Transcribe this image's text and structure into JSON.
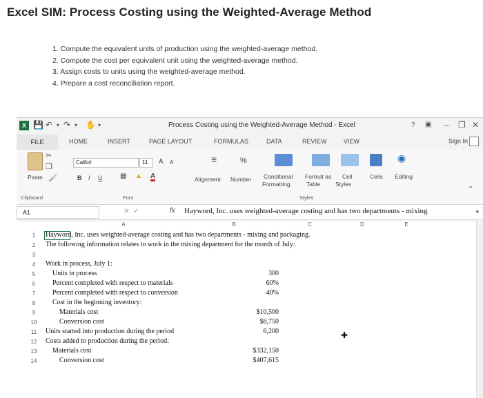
{
  "page": {
    "title": "Excel SIM: Process Costing using the Weighted-Average Method",
    "steps": [
      "1. Compute the equivalent units of production using the weighted-average method.",
      "2. Compute the cost per equivalent unit using the weighted-average method.",
      "3. Assign costs to units using the weighted-average method.",
      "4. Prepare a cost reconciliation report."
    ]
  },
  "excel": {
    "window_title": "Process Costing using the Weighted-Average Method - Excel",
    "help": "?",
    "tabs": [
      "FILE",
      "HOME",
      "INSERT",
      "PAGE LAYOUT",
      "FORMULAS",
      "DATA",
      "REVIEW",
      "VIEW"
    ],
    "sign_in": "Sign In",
    "ribbon": {
      "font_name": "Calibri",
      "font_size": "11",
      "paste": "Paste",
      "bold": "B",
      "italic": "I",
      "underline": "U",
      "grow_font": "A",
      "shrink_font": "A",
      "alignment": "Alignment",
      "number": "Number",
      "percent": "%",
      "conditional_formatting_1": "Conditional",
      "conditional_formatting_2": "Formatting",
      "format_as_table_1": "Format as",
      "format_as_table_2": "Table",
      "cell_styles_1": "Cell",
      "cell_styles_2": "Styles",
      "cells": "Cells",
      "editing": "Editing",
      "group_clipboard": "Clipboard",
      "group_font": "Font",
      "group_styles": "Styles"
    },
    "name_box": "A1",
    "formula_fx": "fx",
    "formula": "Hayword, Inc. uses weighted-average costing and has two departments - mixing",
    "columns": [
      "A",
      "B",
      "C",
      "D",
      "E"
    ],
    "rows": [
      {
        "n": "1",
        "a": "Hayword, Inc. uses weighted-average costing and has two departments - mixing and packaging.",
        "c": ""
      },
      {
        "n": "2",
        "a": "The following information relates to work in the mixing department for the month of July:",
        "c": ""
      },
      {
        "n": "3",
        "a": "",
        "c": ""
      },
      {
        "n": "4",
        "a": "Work in process, July 1:",
        "c": ""
      },
      {
        "n": "5",
        "a": "Units in process",
        "c": "300"
      },
      {
        "n": "6",
        "a": "Percent completed with respect to materials",
        "c": "60%"
      },
      {
        "n": "7",
        "a": "Percent completed with respect to conversion",
        "c": "40%"
      },
      {
        "n": "8",
        "a": "Cost in the beginning inventory:",
        "c": ""
      },
      {
        "n": "9",
        "a": "Materials cost",
        "c": "$10,500"
      },
      {
        "n": "10",
        "a": "Conversion cost",
        "c": "$6,750"
      },
      {
        "n": "11",
        "a": "Units started into production during the period",
        "c": "6,200"
      },
      {
        "n": "12",
        "a": "Costs added to production during the period:",
        "c": ""
      },
      {
        "n": "13",
        "a": "Materials cost",
        "c": "$332,150"
      },
      {
        "n": "14",
        "a": "Conversion cost",
        "c": "$407,615"
      }
    ]
  }
}
